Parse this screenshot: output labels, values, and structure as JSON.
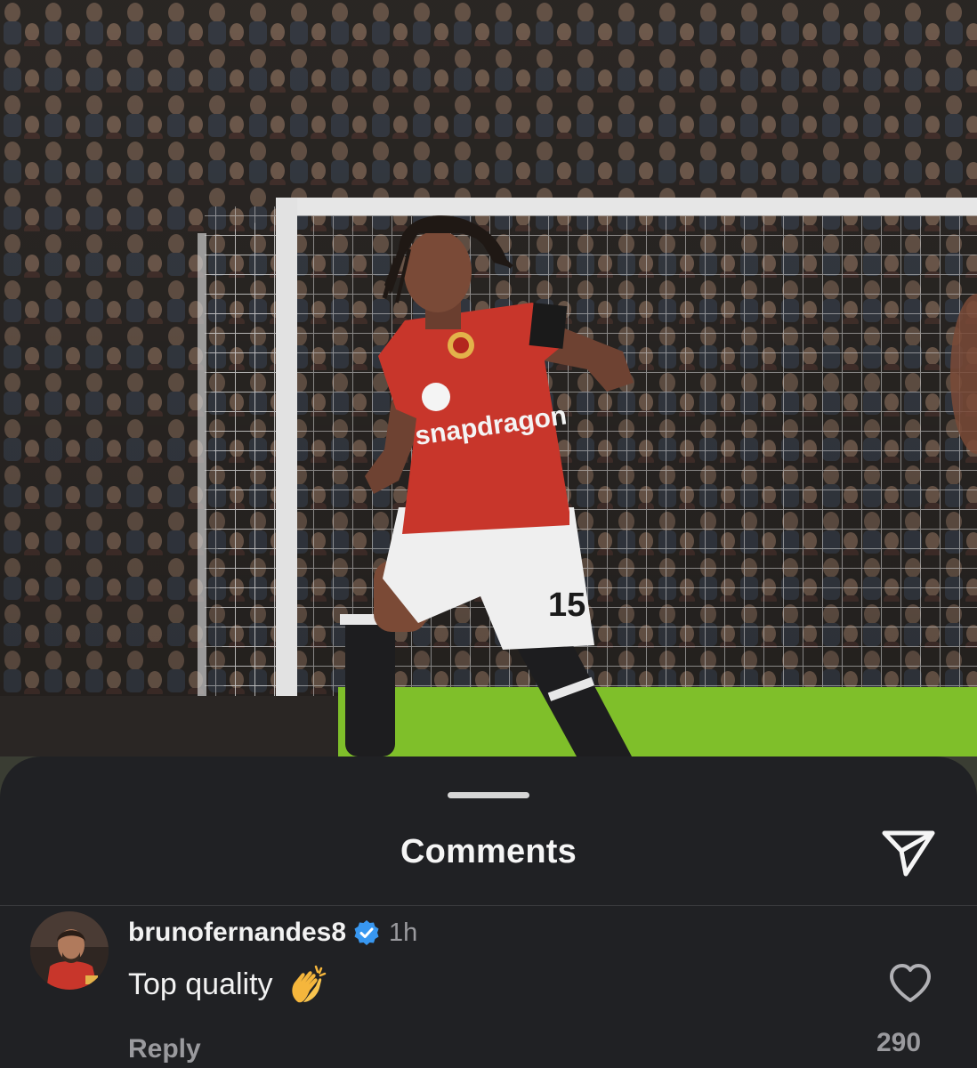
{
  "post_image": {
    "jersey_sponsor": "snapdragon",
    "shorts_number": "15"
  },
  "comments_sheet": {
    "title": "Comments"
  },
  "comment": {
    "username": "brunofernandes8",
    "verified": true,
    "timestamp": "1h",
    "text": "Top quality",
    "emoji": "clapping-hands",
    "reply_label": "Reply",
    "like_count": "290"
  },
  "colors": {
    "sheet_background": "#202124",
    "primary_text": "#f2f2f2",
    "secondary_text": "#9a9a9e",
    "verified_badge": "#3897f0",
    "jersey_red": "#c8362b"
  }
}
